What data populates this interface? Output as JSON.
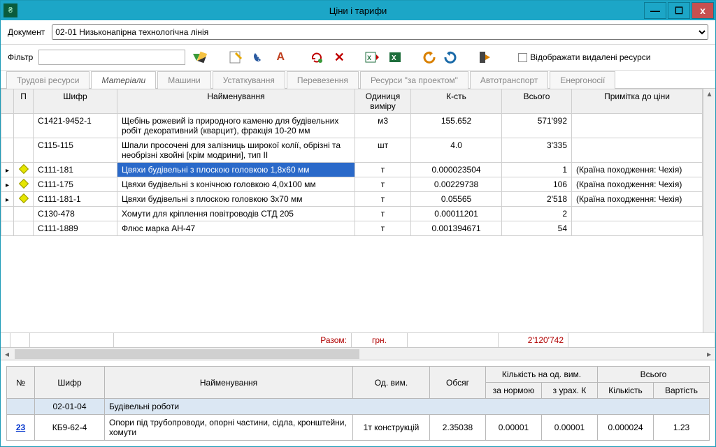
{
  "window": {
    "title": "Ціни і тарифи"
  },
  "doc": {
    "label": "Документ",
    "value": "02-01  Низьконапірна технологічна лінія"
  },
  "filter": {
    "label": "Фільтр",
    "value": ""
  },
  "checkbox_show_deleted": "Відображати видалені ресурси",
  "tabs": [
    "Трудові ресурси",
    "Матеріали",
    "Машини",
    "Устаткування",
    "Перевезення",
    "Ресурси \"за проектом\"",
    "Автотранспорт",
    "Енергоносії"
  ],
  "active_tab": 1,
  "headers": {
    "p": "П",
    "shifr": "Шифр",
    "name": "Найменування",
    "unit": "Одиниця виміру",
    "qty": "К-сть",
    "total": "Всього",
    "note": "Примітка до ціни"
  },
  "rows": [
    {
      "mark": "",
      "shifr": "С1421-9452-1",
      "name": "Щебінь рожевий  із природного каменю для будівельних робіт декоративний (кварцит), фракція 10-20 мм",
      "unit": "м3",
      "qty": "155.652",
      "total": "571'992",
      "note": ""
    },
    {
      "mark": "",
      "shifr": "С115-115",
      "name": "Шпали просочені для залізниць широкої колії, обрізні та необрізні хвойні [крім модрини], тип II",
      "unit": "шт",
      "qty": "4.0",
      "total": "3'335",
      "note": ""
    },
    {
      "mark": "d",
      "shifr": "С111-181",
      "name": "Цвяхи будівельні з плоскою головкою 1,8х60 мм",
      "unit": "т",
      "qty": "0.000023504",
      "total": "1",
      "note": "(Країна походження: Чехія)",
      "selected": true
    },
    {
      "mark": "d",
      "shifr": "С111-175",
      "name": "Цвяхи будівельні з конічною головкою 4,0х100 мм",
      "unit": "т",
      "qty": "0.00229738",
      "total": "106",
      "note": "(Країна походження: Чехія)"
    },
    {
      "mark": "d",
      "shifr": "С111-181-1",
      "name": "Цвяхи будівельні з плоскою головкою 3х70 мм",
      "unit": "т",
      "qty": "0.05565",
      "total": "2'518",
      "note": "(Країна походження: Чехія)"
    },
    {
      "mark": "",
      "shifr": "С130-478",
      "name": "Хомути для кріплення повітроводів СТД 205",
      "unit": "т",
      "qty": "0.00011201",
      "total": "2",
      "note": ""
    },
    {
      "mark": "",
      "shifr": "С111-1889",
      "name": "Флюс марка АН-47",
      "unit": "т",
      "qty": "0.001394671",
      "total": "54",
      "note": ""
    }
  ],
  "summary": {
    "label": "Разом:",
    "unit": "грн.",
    "total": "2'120'742"
  },
  "detail_headers": {
    "num": "№",
    "shifr": "Шифр",
    "name": "Найменування",
    "unit": "Од. вим.",
    "vol": "Обсяг",
    "qty_group": "Кількість на од. вим.",
    "qty_norm": "за нормою",
    "qty_k": "з урах. К",
    "total_group": "Всього",
    "total_qty": "Кількість",
    "total_cost": "Вартість"
  },
  "detail_section": {
    "shifr": "02-01-04",
    "name": "Будівельні роботи"
  },
  "detail_row": {
    "num": "23",
    "link": true,
    "shifr": "КБ9-62-4",
    "name": "Опори під трубопроводи, опорні частини, сідла, кронштейни, хомути",
    "unit": "1т конструкцій",
    "vol": "2.35038",
    "qty_norm": "0.00001",
    "qty_k": "0.00001",
    "total_qty": "0.000024",
    "total_cost": "1.23"
  }
}
